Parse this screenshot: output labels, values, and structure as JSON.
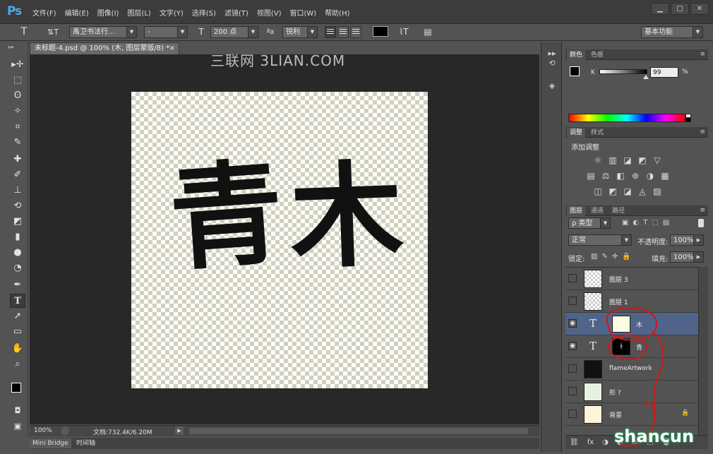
{
  "app": {
    "logo": "Ps"
  },
  "menu": [
    "文件(F)",
    "编辑(E)",
    "图像(I)",
    "图层(L)",
    "文字(Y)",
    "选择(S)",
    "滤镜(T)",
    "视图(V)",
    "窗口(W)",
    "帮助(H)"
  ],
  "window_buttons": [
    "▁",
    "▢",
    "✕"
  ],
  "options": {
    "tool_glyph": "T",
    "orient_glyph": "⇅T",
    "font_family": "禹卫书法行...",
    "font_style": "-",
    "size_glyph": "T",
    "font_size": "200 点",
    "aa_glyph": "ªa",
    "antialias": "锐利",
    "warp_glyph": "⌇T",
    "workspace": "基本功能"
  },
  "document": {
    "tab_title": "未标题-4.psd @ 100% (木, 图层蒙版/8) *",
    "tab_close": "×",
    "canvas_chars": [
      "青",
      "木"
    ],
    "zoom": "100%",
    "doc_info": "文档:732.4K/6.20M",
    "play": "▶"
  },
  "watermark": "三联网 3LIAN.COM",
  "bottom_tabs": [
    "Mini Bridge",
    "时间轴"
  ],
  "tools": [
    "▸✛",
    "⬚",
    "ʘ",
    "✧",
    "⌗",
    "✎",
    "✚",
    "✐",
    "⊥",
    "⟲",
    "◩",
    "▮",
    "●",
    "◔",
    "✒",
    "T",
    "➚",
    "▭",
    "✋",
    "⌕"
  ],
  "color_panel": {
    "tabs": [
      "颜色",
      "色板"
    ],
    "channel": "K",
    "value": "99",
    "pct": "%"
  },
  "adjust_panel": {
    "tabs": [
      "调整",
      "样式"
    ],
    "title": "添加调整",
    "row1": [
      "☼",
      "▥",
      "◪",
      "◩",
      "▽"
    ],
    "row2": [
      "▤",
      "⚖",
      "◧",
      "⊛",
      "◑",
      "▦"
    ],
    "row3": [
      "◫",
      "◩",
      "◪",
      "◬",
      "▨"
    ]
  },
  "layers_panel": {
    "tabs": [
      "图层",
      "通道",
      "路径"
    ],
    "filter": "ρ 类型",
    "filter_icons": [
      "▣",
      "◐",
      "T",
      "⬚",
      "▤"
    ],
    "blend": "正常",
    "opacity_label": "不透明度:",
    "opacity": "100%",
    "lock_label": "锁定:",
    "lock_icons": [
      "▨",
      "✎",
      "✛",
      "🔒"
    ],
    "fill_label": "填充:",
    "fill": "100%",
    "layers": [
      {
        "name": "图层 3",
        "kind": "pixel",
        "visible": false
      },
      {
        "name": "图层 1",
        "kind": "pixel",
        "visible": false
      },
      {
        "name": "木",
        "kind": "text",
        "visible": true,
        "selected": true
      },
      {
        "name": "青",
        "kind": "text",
        "visible": true
      },
      {
        "name": "flameArtwork",
        "kind": "pixel",
        "visible": false
      },
      {
        "name": "形 ?",
        "kind": "pixel",
        "visible": false
      },
      {
        "name": "背景",
        "kind": "pixel",
        "visible": false
      }
    ],
    "footer_icons": [
      "⛓",
      "fx",
      "◑",
      "◐",
      "▭",
      "⬚",
      "🗑"
    ]
  },
  "site_logo": "shancun"
}
